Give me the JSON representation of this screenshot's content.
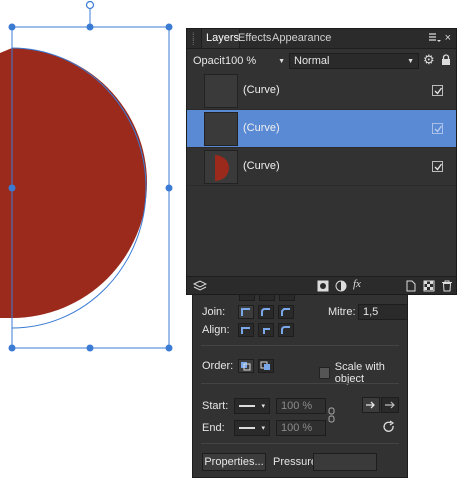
{
  "tabs": {
    "layers": "Layers",
    "effects": "Effects",
    "appearance": "Appearance"
  },
  "opacity": {
    "label": "Opacity:",
    "value": "100 %"
  },
  "blend_mode": "Normal",
  "layers": [
    {
      "name": "(Curve)",
      "visible": true,
      "selected": false
    },
    {
      "name": "(Curve)",
      "visible": true,
      "selected": true
    },
    {
      "name": "(Curve)",
      "visible": true,
      "selected": false
    }
  ],
  "stroke": {
    "join_label": "Join:",
    "align_label": "Align:",
    "mitre_label": "Mitre:",
    "mitre_value": "1,5",
    "order_label": "Order:",
    "scale_with_object": "Scale with object",
    "start_label": "Start:",
    "end_label": "End:",
    "start_size": "100 %",
    "end_size": "100 %",
    "properties_button": "Properties...",
    "pressure_label": "Pressure:"
  },
  "colors": {
    "fill_red": "#9b2a1c",
    "selection_blue": "#3b7bd4",
    "panel_bg": "#323232",
    "row_selected": "#5b8ad4"
  }
}
